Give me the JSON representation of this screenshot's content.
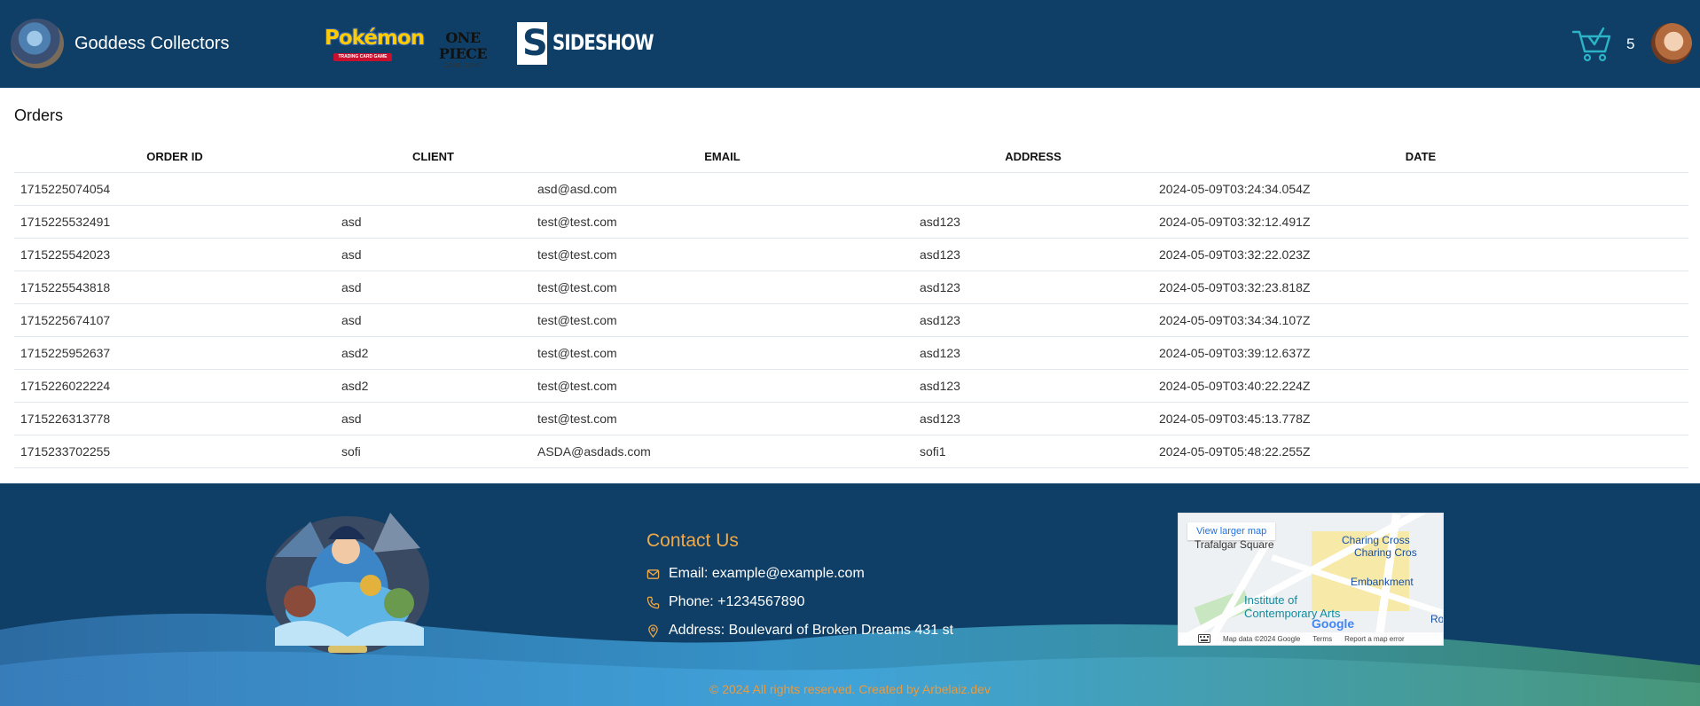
{
  "header": {
    "brand_name": "Goddess Collectors",
    "logos": {
      "pokemon_word": "Pokémon",
      "pokemon_sub": "TRADING CARD GAME",
      "onepiece_word": "ONE PIECE",
      "onepiece_sub": "CARD GAME",
      "sideshow_mark": "S",
      "sideshow_word": "SIDESHOW"
    },
    "cart_count": "5"
  },
  "orders": {
    "title": "Orders",
    "columns": [
      "ORDER ID",
      "CLIENT",
      "EMAIL",
      "ADDRESS",
      "DATE"
    ],
    "rows": [
      [
        "1715225074054",
        "",
        "asd@asd.com",
        "",
        "2024-05-09T03:24:34.054Z"
      ],
      [
        "1715225532491",
        "asd",
        "test@test.com",
        "asd123",
        "2024-05-09T03:32:12.491Z"
      ],
      [
        "1715225542023",
        "asd",
        "test@test.com",
        "asd123",
        "2024-05-09T03:32:22.023Z"
      ],
      [
        "1715225543818",
        "asd",
        "test@test.com",
        "asd123",
        "2024-05-09T03:32:23.818Z"
      ],
      [
        "1715225674107",
        "asd",
        "test@test.com",
        "asd123",
        "2024-05-09T03:34:34.107Z"
      ],
      [
        "1715225952637",
        "asd2",
        "test@test.com",
        "asd123",
        "2024-05-09T03:39:12.637Z"
      ],
      [
        "1715226022224",
        "asd2",
        "test@test.com",
        "asd123",
        "2024-05-09T03:40:22.224Z"
      ],
      [
        "1715226313778",
        "asd",
        "test@test.com",
        "asd123",
        "2024-05-09T03:45:13.778Z"
      ],
      [
        "1715233702255",
        "sofi",
        "ASDA@asdads.com",
        "sofi1",
        "2024-05-09T05:48:22.255Z"
      ]
    ]
  },
  "footer": {
    "contact_title": "Contact Us",
    "email": "Email: example@example.com",
    "phone": "Phone: +1234567890",
    "address": "Address: Boulevard of Broken Dreams 431 st",
    "map": {
      "view_larger": "View larger map",
      "labels": [
        "Trafalgar Square",
        "Charing Cross",
        "Charing Cros",
        "Embankment",
        "Institute of",
        "Contemporary Arts",
        "Ro"
      ],
      "google": "Google",
      "attribution": [
        "Map data ©2024 Google",
        "Terms",
        "Report a map error"
      ]
    },
    "copyright": "© 2024 All rights reserved. Created by Arbelaiz.dev"
  },
  "colors": {
    "header_bg": "#0f3f66",
    "accent_orange": "#f0a94a",
    "cart_teal": "#2bb3c8"
  },
  "icons": [
    "cart-icon",
    "mail-icon",
    "phone-icon",
    "location-pin-icon",
    "keyboard-icon"
  ]
}
